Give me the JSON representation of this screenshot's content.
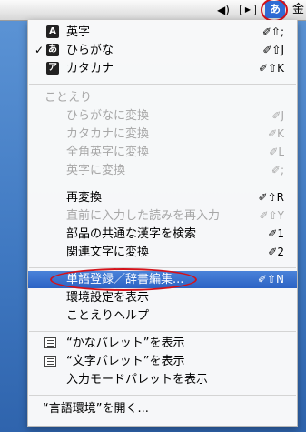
{
  "menubar": {
    "volume_icon": "speaker-icon",
    "keyboard_icon": "keyboard-icon",
    "ime_label": "あ",
    "clock_label": "金"
  },
  "menu": {
    "input_modes": [
      {
        "label": "英字",
        "icon": "A",
        "shortcut": "⇧;",
        "checked": false
      },
      {
        "label": "ひらがな",
        "icon": "あ",
        "shortcut": "⇧J",
        "checked": true
      },
      {
        "label": "カタカナ",
        "icon": "ア",
        "shortcut": "⇧K",
        "checked": false
      }
    ],
    "check_mark": "✓",
    "section_kotoeri": "ことえり",
    "convert_items": [
      {
        "label": "ひらがなに変換",
        "shortcut": "J"
      },
      {
        "label": "カタカナに変換",
        "shortcut": "K"
      },
      {
        "label": "全角英字に変換",
        "shortcut": "L"
      },
      {
        "label": "英字に変換",
        "shortcut": ";"
      }
    ],
    "edit_items": [
      {
        "label": "再変換",
        "shortcut": "⇧R",
        "disabled": false
      },
      {
        "label": "直前に入力した読みを再入力",
        "shortcut": "⇧Y",
        "disabled": true
      },
      {
        "label": "部品の共通な漢字を検索",
        "shortcut": "1",
        "disabled": false
      },
      {
        "label": "関連文字に変換",
        "shortcut": "2",
        "disabled": false
      }
    ],
    "tool_items": [
      {
        "label": "単語登録／辞書編集...",
        "shortcut": "⇧N",
        "selected": true
      },
      {
        "label": "環境設定を表示",
        "shortcut": "",
        "selected": false
      },
      {
        "label": "ことえりヘルプ",
        "shortcut": "",
        "selected": false
      }
    ],
    "palette_items": [
      {
        "label": "“かなパレット”を表示",
        "icon": true
      },
      {
        "label": "“文字パレット”を表示",
        "icon": true
      },
      {
        "label": "入力モードパレットを表示",
        "icon": false
      }
    ],
    "language_env": "“言語環境”を開く..."
  }
}
